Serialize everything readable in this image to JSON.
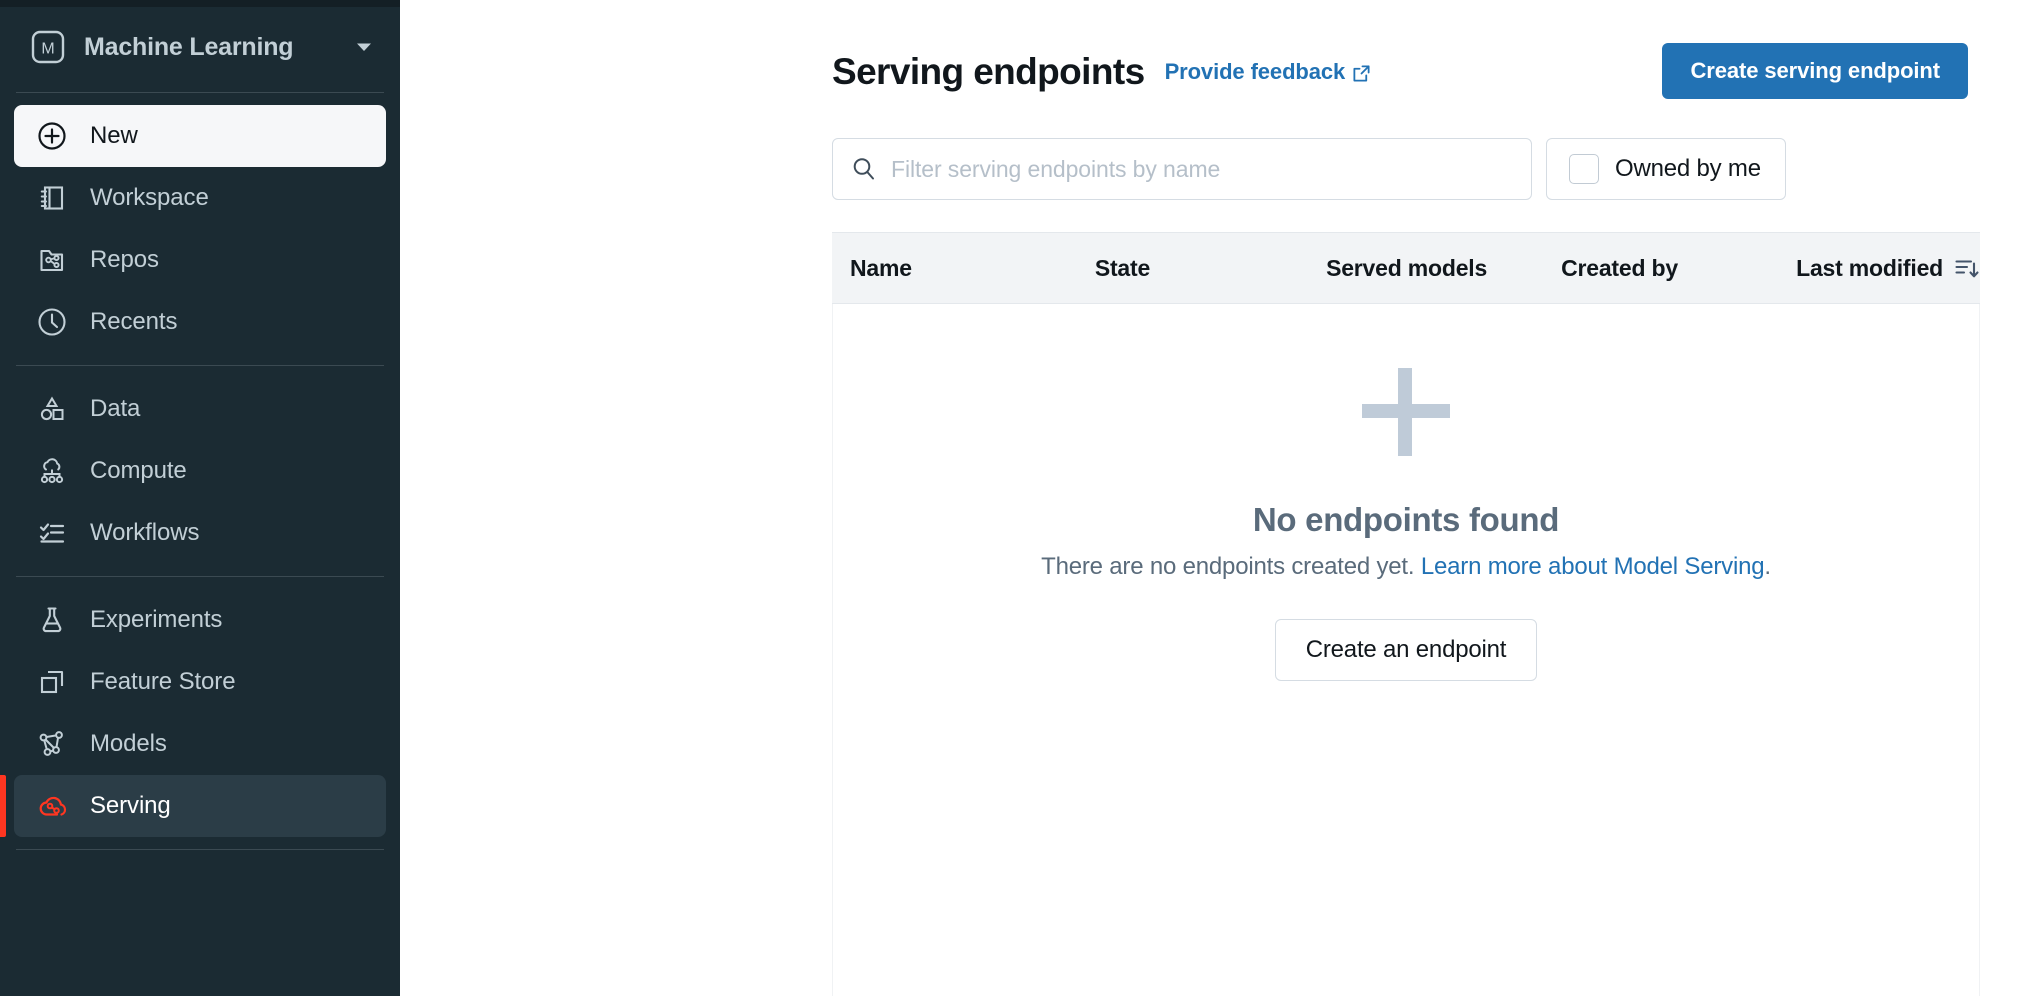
{
  "sidebar": {
    "workspace": {
      "label": "Machine Learning",
      "badge_letter": "M",
      "icon": "ml-persona-icon",
      "caret_icon": "chevron-down-icon"
    },
    "items": [
      {
        "label": "New",
        "icon": "plus-circle-icon",
        "state": "highlighted"
      },
      {
        "label": "Workspace",
        "icon": "workspace-icon",
        "state": "normal"
      },
      {
        "label": "Repos",
        "icon": "repos-icon",
        "state": "normal"
      },
      {
        "label": "Recents",
        "icon": "clock-icon",
        "state": "normal"
      },
      {
        "label": "Data",
        "icon": "data-shapes-icon",
        "state": "normal"
      },
      {
        "label": "Compute",
        "icon": "compute-icon",
        "state": "normal"
      },
      {
        "label": "Workflows",
        "icon": "checklist-icon",
        "state": "normal"
      },
      {
        "label": "Experiments",
        "icon": "flask-icon",
        "state": "normal"
      },
      {
        "label": "Feature Store",
        "icon": "layers-icon",
        "state": "normal"
      },
      {
        "label": "Models",
        "icon": "model-graph-icon",
        "state": "normal"
      },
      {
        "label": "Serving",
        "icon": "serving-cloud-icon",
        "state": "active"
      }
    ],
    "colors": {
      "background": "#1b2b33",
      "active_accent": "#ff3621",
      "active_background": "#2b3d47",
      "label": "#c2cfd6"
    }
  },
  "header": {
    "title": "Serving endpoints",
    "feedback_label": "Provide feedback",
    "feedback_icon": "external-link-icon",
    "create_button_label": "Create serving endpoint",
    "accent_color": "#2272b4"
  },
  "filters": {
    "search_placeholder": "Filter serving endpoints by name",
    "search_value": "",
    "search_icon": "search-icon",
    "owned_by_me_label": "Owned by me",
    "owned_by_me_checked": false
  },
  "table": {
    "columns": [
      {
        "label": "Name",
        "sorted": false
      },
      {
        "label": "State",
        "sorted": false
      },
      {
        "label": "Served models",
        "sorted": false
      },
      {
        "label": "Created by",
        "sorted": false
      },
      {
        "label": "Last modified",
        "sorted": true,
        "sort_icon": "sort-descending-icon",
        "sort_direction": "desc"
      }
    ],
    "rows": []
  },
  "empty_state": {
    "icon": "large-plus-icon",
    "title": "No endpoints found",
    "subtitle_text": "There are no endpoints created yet. ",
    "subtitle_link": "Learn more about Model Serving",
    "subtitle_suffix": ".",
    "button_label": "Create an endpoint"
  }
}
